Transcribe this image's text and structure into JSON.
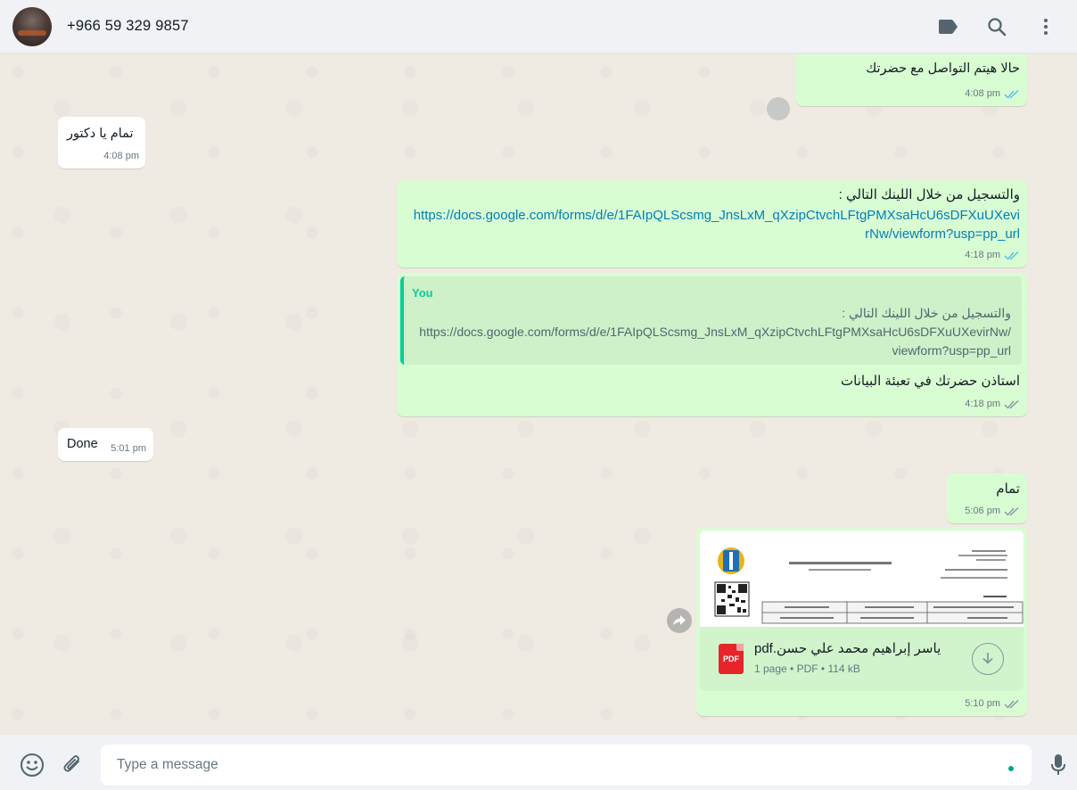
{
  "header": {
    "contact_name": "+966 59 329 9857",
    "icons": [
      "label-icon",
      "search-icon",
      "menu-dots-icon"
    ]
  },
  "colors": {
    "outgoing_bubble": "#d9fdd3",
    "incoming_bubble": "#ffffff",
    "accent": "#00a884",
    "link": "#027eb5",
    "read_ticks": "#53bdeb"
  },
  "messages": [
    {
      "direction": "out",
      "text": "حالا هيتم التواصل مع حضرتك",
      "time": "4:08 pm",
      "status": "read"
    },
    {
      "direction": "in",
      "text": "تمام يا دكتور",
      "time": "4:08 pm"
    },
    {
      "direction": "out",
      "text": "والتسجيل من خلال اللينك التالي :",
      "link": "https://docs.google.com/forms/d/e/1FAIpQLScsmg_JnsLxM_qXzipCtvchLFtgPMXsaHcU6sDFXuUXevirNw/viewform?usp=pp_url",
      "link_line1": "https://docs.google.com/forms/d/e/1FAIpQLScsmg_JnsLxM_qXzipCtvchLFtgPMXsaHcU6sDFXuUXevi",
      "link_line2": "rNw/viewform?usp=pp_url",
      "time": "4:18 pm",
      "status": "read"
    },
    {
      "direction": "out",
      "quote": {
        "author": "You",
        "text_line1": "والتسجيل من خلال اللينك التالي :",
        "text_line2": "https://docs.google.com/forms/d/e/1FAIpQLScsmg_JnsLxM_qXzipCtvchLFtgPMXsaHcU6sDFXuUXevirNw/",
        "text_line3": "viewform?usp=pp_url"
      },
      "text": "استاذن حضرتك في تعبئة البيانات",
      "time": "4:18 pm",
      "status": "delivered"
    },
    {
      "direction": "in",
      "text": "Done",
      "time": "5:01 pm"
    },
    {
      "direction": "out",
      "text": "تمام",
      "time": "5:06 pm",
      "status": "delivered"
    },
    {
      "direction": "out",
      "document": {
        "file_name": "ياسر إبراهيم محمد علي حسن.pdf",
        "pages": "1 page",
        "type": "PDF",
        "size": "114 kB",
        "icon_label": "PDF"
      },
      "time": "5:10 pm",
      "status": "delivered"
    }
  ],
  "composer": {
    "placeholder": "Type a message",
    "icons": [
      "emoji-icon",
      "attach-icon",
      "mic-icon"
    ]
  },
  "doc_preview": {
    "logo_caption": "RAWHANDE",
    "heading": "إيصال تسجيل دورة تدريبية",
    "invoice_number": "فاتورة ضريبية (20230007)",
    "company_lines": [
      "شركة رايات الخبرة",
      "مؤسسة للدورات التعليمية والتطبيقات",
      "رايات الخبرة",
      "الرقم الضريبي : 523-869-273",
      "العنوان : بن مريوان الدقي الجيزة"
    ],
    "section_title": "بيانات الطالب:",
    "table_rows": [
      [
        "اسم الطالب : ياسر إبراهيم محمد علي حسن",
        "رقم الطالب : 23486",
        "تاريخ التسجيل : 24-06-2023"
      ],
      [
        "الجنسية : مصري",
        "رقم الهوية : A29567355",
        "الجوال : 00966593298857"
      ]
    ]
  }
}
